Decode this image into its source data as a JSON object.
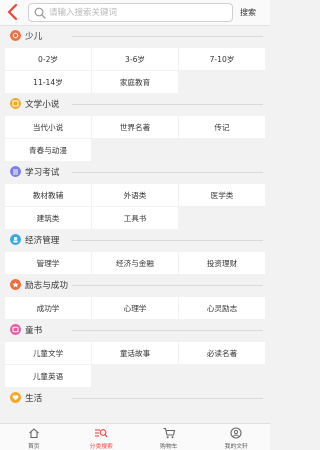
{
  "header": {
    "search_placeholder": "请输入搜索关键词",
    "search_button": "搜索"
  },
  "sections": [
    {
      "title": "少儿",
      "color": "#f37043",
      "items": [
        "0-2岁",
        "3-6岁",
        "7-10岁",
        "11-14岁",
        "家庭教育"
      ]
    },
    {
      "title": "文学小说",
      "color": "#f5a623",
      "items": [
        "当代小说",
        "世界名著",
        "传记",
        "青春与动漫"
      ]
    },
    {
      "title": "学习考试",
      "color": "#7b7ee8",
      "items": [
        "教材教辅",
        "外语类",
        "医学类",
        "建筑类",
        "工具书"
      ]
    },
    {
      "title": "经济管理",
      "color": "#39a9e3",
      "items": [
        "管理学",
        "经济与金融",
        "投资理财"
      ]
    },
    {
      "title": "励志与成功",
      "color": "#f06a3b",
      "items": [
        "成功学",
        "心理学",
        "心灵励志"
      ]
    },
    {
      "title": "童书",
      "color": "#e85aa0",
      "items": [
        "儿童文学",
        "童话故事",
        "必读名著",
        "儿童英语"
      ]
    },
    {
      "title": "生活",
      "color": "#f5a623",
      "items": []
    }
  ],
  "tabbar": [
    {
      "label": "首页",
      "icon": "home-icon"
    },
    {
      "label": "分类搜索",
      "icon": "category-search-icon"
    },
    {
      "label": "购物车",
      "icon": "cart-icon"
    },
    {
      "label": "我的文轩",
      "icon": "profile-icon"
    }
  ],
  "colors": {
    "accent": "#e8473d"
  }
}
